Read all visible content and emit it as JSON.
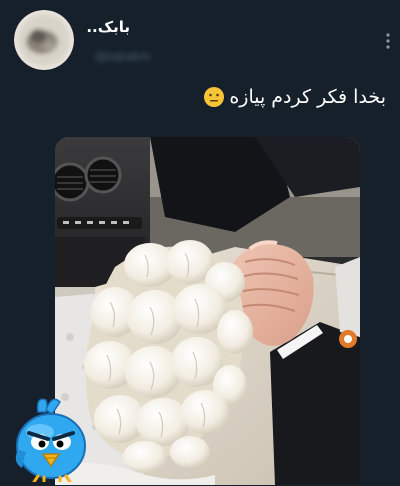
{
  "tweet": {
    "display_name": "بابک..",
    "handle": "@babakm",
    "text": "بخدا فکر کردم پیازه",
    "emoji": "neutral-face-emoji",
    "menu_icon": "more-vertical-icon"
  },
  "colors": {
    "background": "#15202b",
    "text": "#ffffff",
    "secondary": "#5c6b7a",
    "bird_blue": "#2fa8f0"
  },
  "sticker": {
    "icon": "angry-bird-sticker-icon"
  }
}
